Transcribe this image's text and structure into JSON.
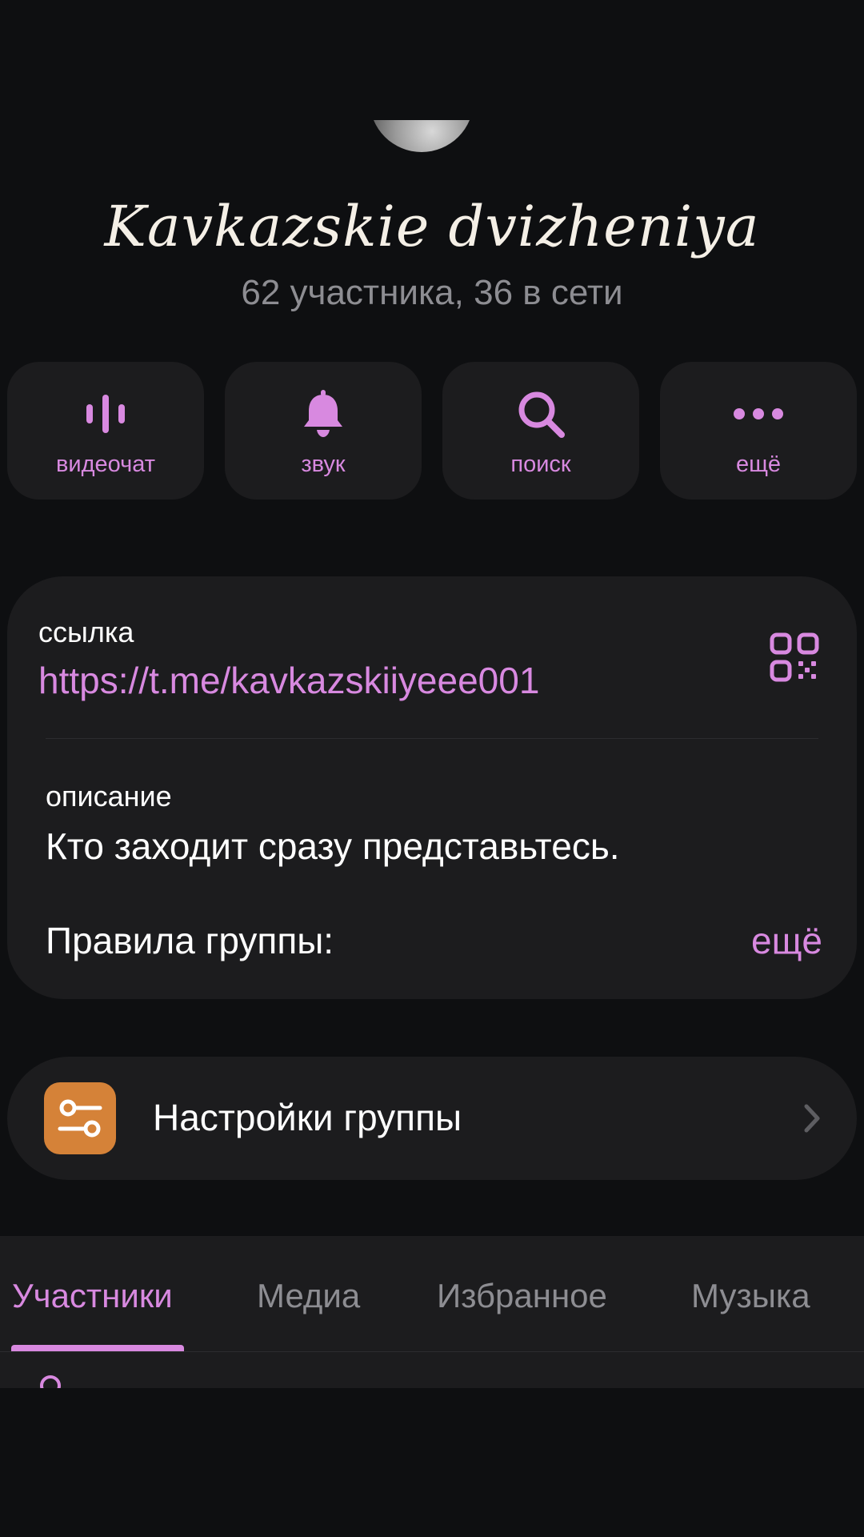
{
  "header": {
    "title": "Kavkazskie dvizheniya",
    "subtitle": "62 участника, 36 в сети"
  },
  "actions": [
    {
      "label": "видеочат",
      "icon": "voice-chat-icon"
    },
    {
      "label": "звук",
      "icon": "bell-icon"
    },
    {
      "label": "поиск",
      "icon": "search-icon"
    },
    {
      "label": "ещё",
      "icon": "more-icon"
    }
  ],
  "info": {
    "link_label": "ссылка",
    "link_value": "https://t.me/kavkazskiiyeee001",
    "description_label": "описание",
    "description_value": "Кто заходит сразу представьтесь.",
    "rules_label": "Правила группы:",
    "more_label": "ещё"
  },
  "settings": {
    "label": "Настройки группы",
    "icon_color": "#d58238"
  },
  "tabs": [
    {
      "label": "Участники",
      "active": true
    },
    {
      "label": "Медиа",
      "active": false
    },
    {
      "label": "Избранное",
      "active": false
    },
    {
      "label": "Музыка",
      "active": false
    }
  ],
  "colors": {
    "accent": "#d889e0",
    "background": "#0e0f11",
    "card": "#1c1c1e",
    "secondary_text": "#8d8d92"
  }
}
